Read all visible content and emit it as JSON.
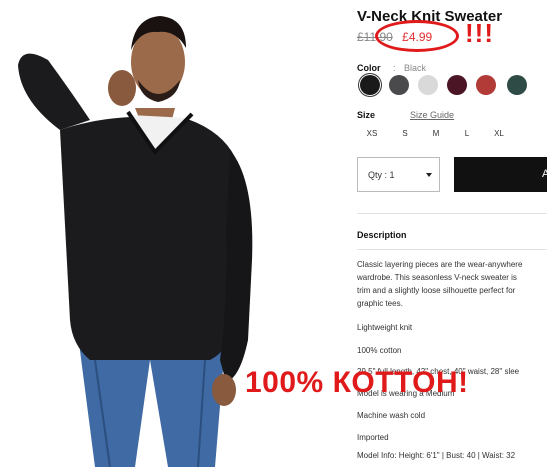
{
  "product": {
    "title": "V-Neck Knit Sweater",
    "price_old": "£11.90",
    "price_new": "£4.99",
    "color_label": "Color",
    "color_sep": ":",
    "color_value": "Black",
    "swatches": [
      {
        "name": "black",
        "color": "#1a1a1a",
        "selected": true
      },
      {
        "name": "charcoal",
        "color": "#4a4a4c"
      },
      {
        "name": "light-grey",
        "color": "#d9d9d9"
      },
      {
        "name": "burgundy",
        "color": "#4b1526"
      },
      {
        "name": "red",
        "color": "#b23a37"
      },
      {
        "name": "dark-green",
        "color": "#2e4c45"
      }
    ],
    "size_label": "Size",
    "size_guide": "Size Guide",
    "sizes": [
      "XS",
      "S",
      "M",
      "L",
      "XL"
    ],
    "quantity": "Qty : 1",
    "add_bag_glyph": "A"
  },
  "description": {
    "heading": "Description",
    "paragraph": [
      "Classic layering pieces are the wear-anywhere",
      "wardrobe. This seasonless V-neck sweater is",
      "trim and a slightly loose silhouette perfect for",
      "graphic tees."
    ],
    "details": [
      "Lightweight knit",
      "100% cotton",
      "29.5\" full length, 42\" chest, 40\" waist, 28\" slee",
      "Model is wearing a Medium",
      "Machine wash cold",
      "Imported",
      "Model Info: Height: 6'1\" | Bust: 40 | Waist: 32"
    ]
  },
  "annotations": {
    "exclaim": "!!!",
    "cotton": "100% КОТТОН!"
  },
  "colors": {
    "accent_red": "#e01a1a",
    "sale_red": "#e03030"
  }
}
